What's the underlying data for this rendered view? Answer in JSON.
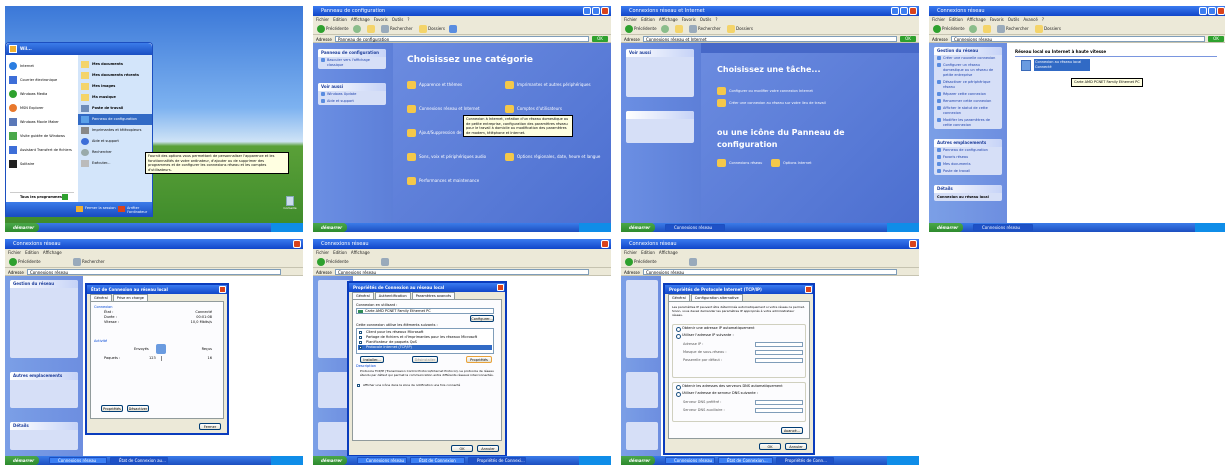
{
  "tiles": {
    "t1": {
      "user_name": "Wil...",
      "menu_left": [
        "Internet",
        "Courrier électronique",
        "Windows Media",
        "MSN Explorer",
        "Windows Movie Maker",
        "Visite guidée de Windows",
        "Assistant Transfert de fichiers",
        "Solitaire"
      ],
      "all_programs": "Tous les programmes",
      "menu_right": [
        "Mes documents",
        "Mes documents récents",
        "Mes images",
        "Ma musique",
        "Poste de travail",
        "Panneau de configuration",
        "Imprimantes et télécopieurs",
        "Aide et support",
        "Rechercher",
        "Exécuter..."
      ],
      "logoff": "Fermer la session",
      "shutdown": "Arrêter l'ordinateur",
      "tooltip": "Fournit des options vous permettant de personnaliser l'apparence et les fonctionnalités de votre ordinateur, d'ajouter ou de supprimer des programmes et de configurer les connexions réseau et les comptes d'utilisateurs.",
      "recycle": "Corbeille",
      "start": "démarrer"
    },
    "t2": {
      "title": "Panneau de configuration",
      "menu": [
        "Fichier",
        "Edition",
        "Affichage",
        "Favoris",
        "Outils",
        "?"
      ],
      "back": "Précédente",
      "search": "Rechercher",
      "folders": "Dossiers",
      "address_label": "Adresse",
      "address": "Panneau de configuration",
      "go": "OK",
      "panel_head": "Panneau de configuration",
      "panel_item": "Basculer vers l'affichage classique",
      "see_also": "Voir aussi",
      "see_also_items": [
        "Windows Update",
        "Aide et support"
      ],
      "heading": "Choisissez une catégorie",
      "categories": [
        "Apparence et thèmes",
        "Connexions réseau et Internet",
        "Ajout/Suppression de programmes",
        "Sons, voix et périphériques audio",
        "Performances et maintenance",
        "Imprimantes et autres périphériques",
        "Comptes d'utilisateurs",
        "Options régionales, date, heure et langue"
      ],
      "tooltip": "Connexion à Internet, création d'un réseau domestique ou de petite entreprise, configuration des paramètres réseau pour le travail à domicile ou modification des paramètres de modem, téléphone et Internet.",
      "start": "démarrer"
    },
    "t3": {
      "title": "Connexions réseau et Internet",
      "address": "Connexions réseau et Internet",
      "heading1": "Choisissez une tâche...",
      "tasks": [
        "Configurer ou modifier votre connexion Internet",
        "Créer une connexion au réseau sur votre lieu de travail"
      ],
      "heading2": "ou une icône du Panneau de configuration",
      "icons": [
        "Connexions réseau",
        "Options Internet"
      ],
      "start": "démarrer",
      "taskbar_item": "Connexions réseau"
    },
    "t4": {
      "title": "Connexions réseau",
      "menu": [
        "Fichier",
        "Edition",
        "Affichage",
        "Favoris",
        "Outils",
        "Avancé",
        "?"
      ],
      "address": "Connexions réseau",
      "section": "Réseau local ou Internet à haute vitesse",
      "conn_name": "Connexion au réseau local",
      "conn_status": "Connecté",
      "tooltip": "Carte AMD PCNET Family Ethernet PC",
      "tasks_head": "Gestion du réseau",
      "tasks": [
        "Créer une nouvelle connexion",
        "Configurer un réseau domestique ou un réseau de petite entreprise",
        "Désactiver ce périphérique réseau",
        "Réparer cette connexion",
        "Renommer cette connexion",
        "Afficher le statut de cette connexion",
        "Modifier les paramètres de cette connexion"
      ],
      "other_head": "Autres emplacements",
      "other": [
        "Panneau de configuration",
        "Favoris réseau",
        "Mes documents",
        "Poste de travail"
      ],
      "details_head": "Détails",
      "details": "Connexion au réseau local",
      "start": "démarrer",
      "taskbar_item": "Connexions réseau"
    },
    "t5": {
      "dlg_title": "État de Connexion au réseau local",
      "tabs": [
        "Général",
        "Prise en charge"
      ],
      "group1": "Connexion",
      "rows": [
        [
          "État :",
          "Connecté"
        ],
        [
          "Durée :",
          "00:01:08"
        ],
        [
          "Vitesse :",
          "10,0 Mbits/s"
        ]
      ],
      "group2": "Activité",
      "sent": "Envoyés",
      "received": "Reçus",
      "packets_label": "Paquets :",
      "packets_sent": "123",
      "packets_recv": "16",
      "btn_props": "Propriétés",
      "btn_disable": "Désactiver",
      "btn_close": "Fermer",
      "start": "démarrer",
      "taskbar": [
        "Connexions réseau",
        "État de Connexion au..."
      ]
    },
    "t6": {
      "dlg_title": "Propriétés de Connexion au réseau local",
      "tabs": [
        "Général",
        "Authentification",
        "Paramètres avancés"
      ],
      "connect_using": "Connexion en utilisant :",
      "adapter": "Carte AMD PCNET Family Ethernet PC",
      "configure": "Configurer...",
      "uses": "Cette connexion utilise les éléments suivants :",
      "items": [
        "Client pour les réseaux Microsoft",
        "Partage de fichiers et d'imprimantes pour les réseaux Microsoft",
        "Planificateur de paquets QoS",
        "Protocole Internet (TCP/IP)"
      ],
      "install": "Installer...",
      "uninstall": "Désinstaller",
      "properties": "Propriétés",
      "desc_head": "Description",
      "desc": "Protocole TCP/IP (Transmission Control Protocol/Internet Protocol). Le protocole de réseau étendu par défaut qui permet la communication entre différents réseaux interconnectés.",
      "notify": "Afficher une icône dans la zone de notification une fois connecté",
      "ok": "OK",
      "cancel": "Annuler",
      "start": "démarrer",
      "taskbar": [
        "Connexions réseau",
        "État de Connexion au...",
        "Propriétés de Connexi..."
      ]
    },
    "t7": {
      "dlg_title": "Propriétés de Protocole Internet (TCP/IP)",
      "tabs": [
        "Général",
        "Configuration alternative"
      ],
      "intro": "Les paramètres IP peuvent être déterminés automatiquement si votre réseau le permet. Sinon, vous devez demander les paramètres IP appropriés à votre administrateur réseau.",
      "r1": "Obtenir une adresse IP automatiquement",
      "r2": "Utiliser l'adresse IP suivante :",
      "f1": "Adresse IP :",
      "f2": "Masque de sous-réseau :",
      "f3": "Passerelle par défaut :",
      "r3": "Obtenir les adresses des serveurs DNS automatiquement",
      "r4": "Utiliser l'adresse de serveur DNS suivante :",
      "f4": "Serveur DNS préféré :",
      "f5": "Serveur DNS auxiliaire :",
      "advanced": "Avancé...",
      "ok": "OK",
      "cancel": "Annuler",
      "start": "démarrer",
      "taskbar": [
        "Connexions réseau",
        "État de Connexion...",
        "Propriétés de Conn..."
      ]
    }
  },
  "colors": {
    "xp_blue": "#1146c9",
    "start_green": "#2d8a2d",
    "panel_blue": "#6d8ee0",
    "dialog_bg": "#ece9d8"
  }
}
